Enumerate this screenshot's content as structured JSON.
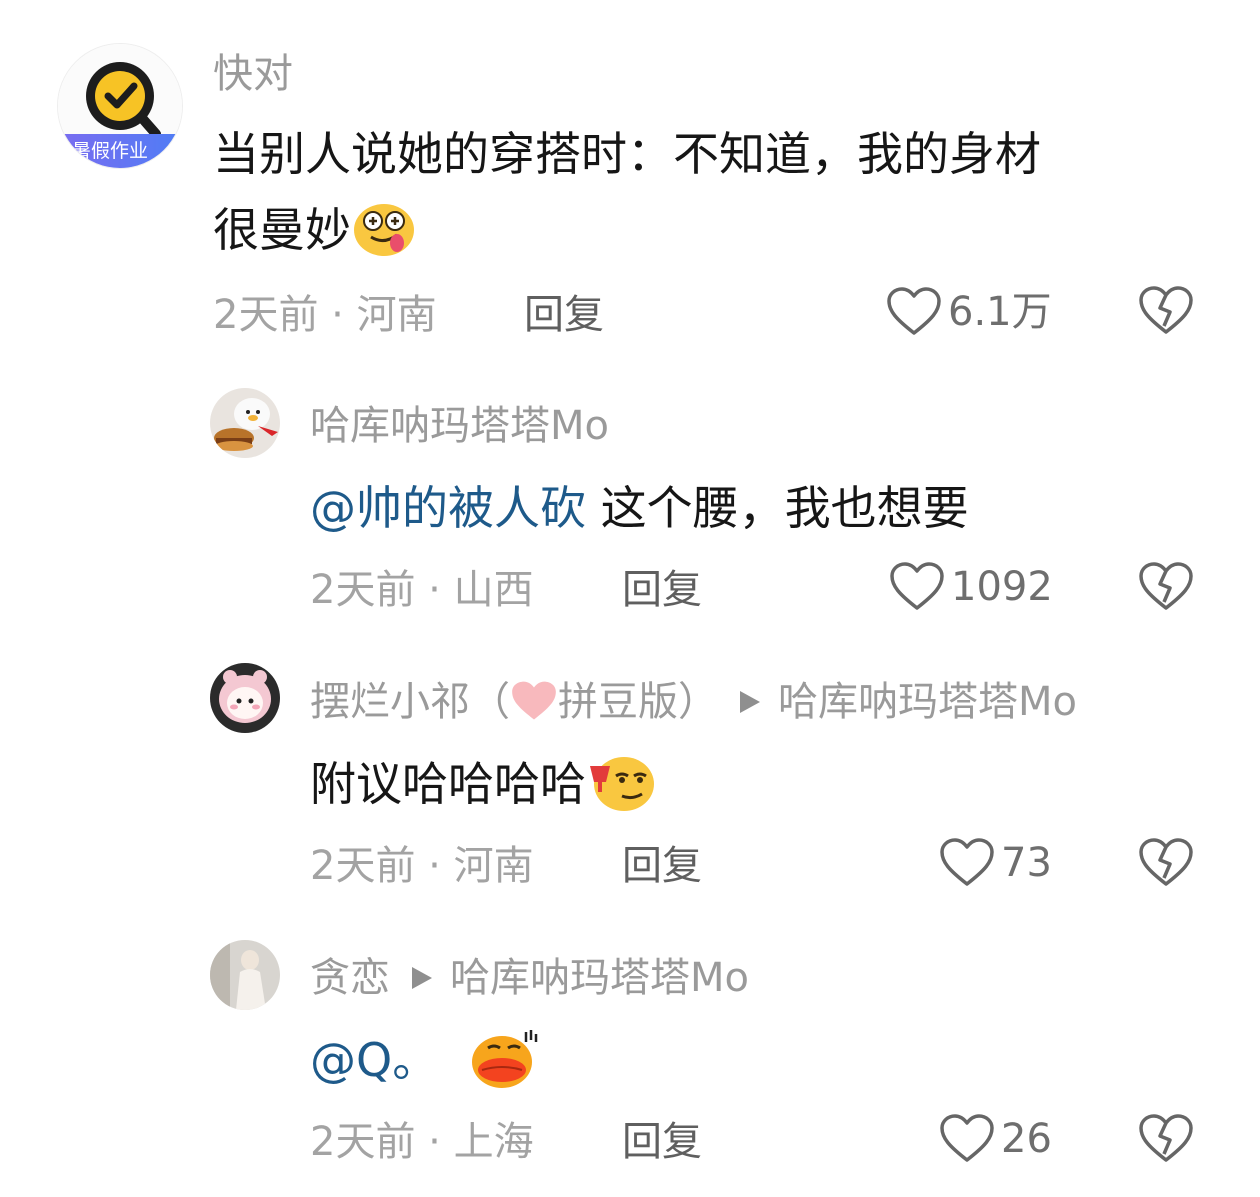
{
  "comments": [
    {
      "author": "快对",
      "avatar_badge": "暑假作业",
      "text_line1": "当别人说她的穿搭时：不知道，我的身材",
      "text_line2": "很曼妙",
      "emoji": "drooling-face-emoji",
      "time": "2天前",
      "location": "河南",
      "reply_label": "回复",
      "likes": "6.1万"
    },
    {
      "author": "哈库呐玛塔塔Mo",
      "mention": "@帅的被人砍",
      "text": " 这个腰，我也想要",
      "time": "2天前",
      "location": "山西",
      "reply_label": "回复",
      "likes": "1092"
    },
    {
      "author_prefix": "摆烂小祁（",
      "author_suffix": "拼豆版）",
      "reply_to": "哈库呐玛塔塔Mo",
      "text": "附议哈哈哈哈",
      "emoji": "smirk-wine-emoji",
      "time": "2天前",
      "location": "河南",
      "reply_label": "回复",
      "likes": "73"
    },
    {
      "author": "贪恋",
      "reply_to": "哈库呐玛塔塔Mo",
      "mention": "@Q。",
      "emoji": "duck-lips-emoji",
      "time": "2天前",
      "location": "上海",
      "reply_label": "回复",
      "likes": "26"
    }
  ],
  "separator": " · ",
  "colors": {
    "mention": "#1e5a8a",
    "meta": "#a3a3a3",
    "name": "#9a9a9a",
    "brand_yellow": "#f7c325"
  }
}
